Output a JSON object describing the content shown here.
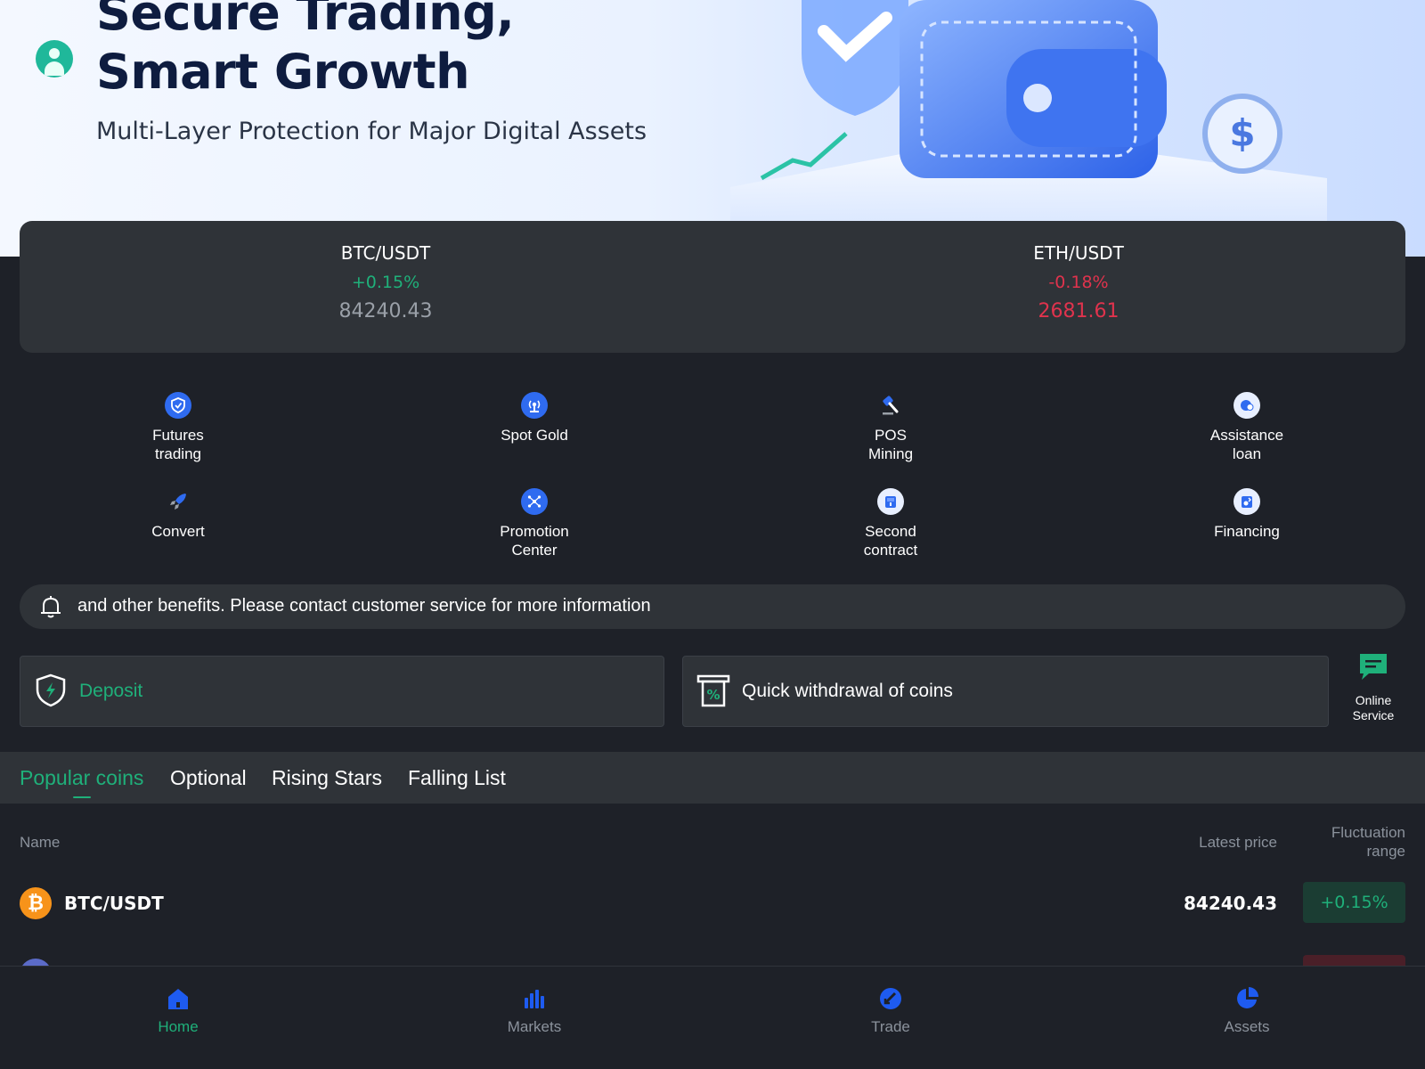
{
  "banner": {
    "title_line1": "Secure Trading,",
    "title_line2": "Smart Growth",
    "subtitle": "Multi-Layer Protection for Major Digital Assets"
  },
  "tickers": [
    {
      "pair": "BTC/USDT",
      "change": "+0.15%",
      "price": "84240.43",
      "trend": "up"
    },
    {
      "pair": "ETH/USDT",
      "change": "-0.18%",
      "price": "2681.61",
      "trend": "down"
    }
  ],
  "features": [
    {
      "label": "Futures\ntrading",
      "icon": "shield-check-icon"
    },
    {
      "label": "Spot Gold",
      "icon": "broadcast-icon"
    },
    {
      "label": "POS\nMining",
      "icon": "hammer-icon"
    },
    {
      "label": "Assistance\nloan",
      "icon": "loan-icon"
    },
    {
      "label": "Convert",
      "icon": "rocket-icon"
    },
    {
      "label": "Promotion\nCenter",
      "icon": "network-icon"
    },
    {
      "label": "Second\ncontract",
      "icon": "contract-icon"
    },
    {
      "label": "Financing",
      "icon": "financing-icon"
    }
  ],
  "notice": {
    "text": "and other benefits. Please contact customer service for more information",
    "icon": "bell-icon"
  },
  "actions": {
    "deposit_label": "Deposit",
    "withdraw_label": "Quick withdrawal of coins",
    "online_service_label": "Online\nService"
  },
  "tabs": [
    "Popular coins",
    "Optional",
    "Rising Stars",
    "Falling List"
  ],
  "table": {
    "col_name": "Name",
    "col_price": "Latest price",
    "col_range": "Fluctuation\nrange",
    "rows": [
      {
        "pair": "BTC/USDT",
        "price": "84240.43",
        "change": "+0.15%",
        "logo_glyph": "₿"
      }
    ]
  },
  "bottom_nav": [
    {
      "label": "Home",
      "icon": "home-icon",
      "active": true
    },
    {
      "label": "Markets",
      "icon": "bar-chart-icon",
      "active": false
    },
    {
      "label": "Trade",
      "icon": "trade-icon",
      "active": false
    },
    {
      "label": "Assets",
      "icon": "pie-chart-icon",
      "active": false
    }
  ],
  "colors": {
    "accent_green": "#1fb07a",
    "down_red": "#e0334d",
    "icon_blue": "#2f6bf0",
    "nav_blue": "#1e5bf0",
    "card_bg": "#2f3338",
    "page_bg": "#1e2128"
  }
}
